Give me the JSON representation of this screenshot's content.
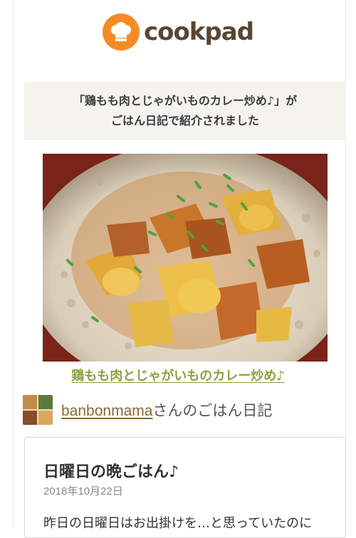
{
  "header": {
    "logo_text": "cookpad",
    "logo_icon": "chef-hat-icon",
    "brand_color": "#f48b26"
  },
  "notice": {
    "line1": "「鶏もも肉とじゃがいものカレー炒め♪」が",
    "line2": "ごはん日記で紹介されました"
  },
  "recipe": {
    "link_text": "鶏もも肉とじゃがいものカレー炒め♪",
    "link_color": "#8aa33a"
  },
  "author": {
    "name": "banbonmama",
    "suffix": "さんのごはん日記"
  },
  "diary": {
    "title": "日曜日の晩ごはん♪",
    "date": "2018年10月22日",
    "body_preview": "昨日の日曜日はお出掛けを…と思っていたのに"
  }
}
